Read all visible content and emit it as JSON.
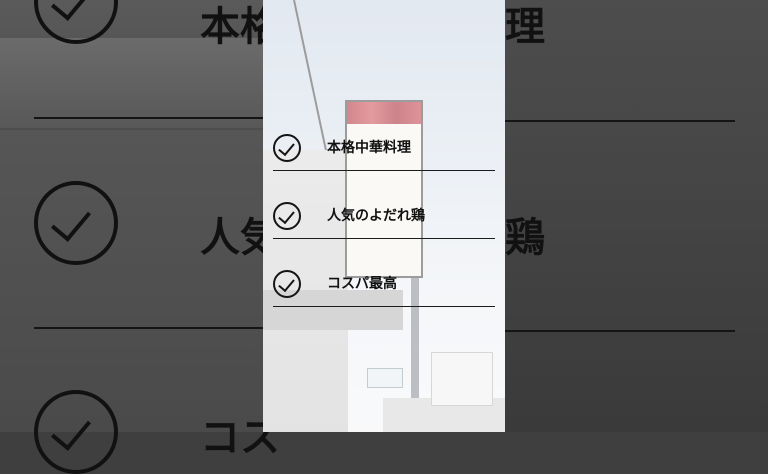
{
  "checklist": {
    "items": [
      {
        "label": "本格中華料理",
        "icon": "check-circle-icon"
      },
      {
        "label": "人気のよだれ鶏",
        "icon": "check-circle-icon"
      },
      {
        "label": "コスパ最高",
        "icon": "check-circle-icon"
      }
    ]
  },
  "background_echo": {
    "left_text": "人気",
    "right_text": "鶏",
    "top_left_text": "本格",
    "bottom_left_text": "コス",
    "top_right_text": "理"
  },
  "colors": {
    "text": "#111111",
    "panel_dim": "#444444",
    "sign_accent": "#b0323c"
  }
}
